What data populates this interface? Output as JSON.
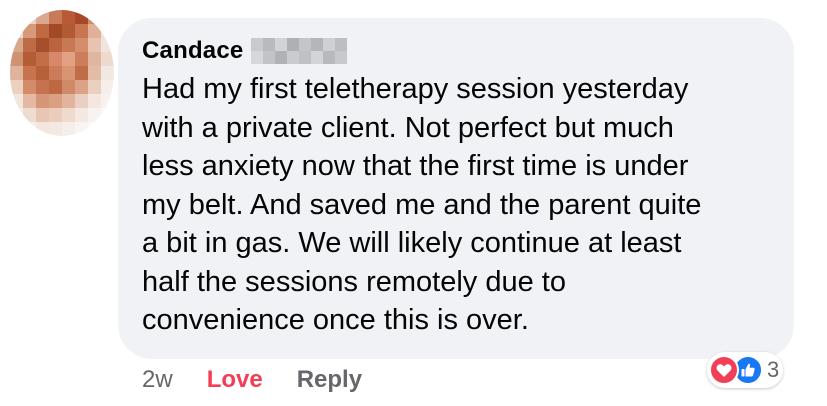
{
  "comment": {
    "author": "Candace",
    "text_lines": [
      "Had my first teletherapy session yesterday",
      "with a private client. Not perfect but much",
      "less anxiety now that the first time is under",
      "my belt. And saved me and the parent quite",
      "a bit in gas. We will likely continue at least",
      "half the sessions remotely due to",
      "convenience once this is over."
    ],
    "timestamp": "2w",
    "love_label": "Love",
    "reply_label": "Reply",
    "reactions": {
      "icons": [
        "love-icon",
        "like-icon"
      ],
      "count": "3"
    }
  },
  "colors": {
    "bubble": "#f0f2f5",
    "text": "#050505",
    "secondary": "#65676b",
    "love": "#f33e58",
    "like": "#1877f2"
  }
}
